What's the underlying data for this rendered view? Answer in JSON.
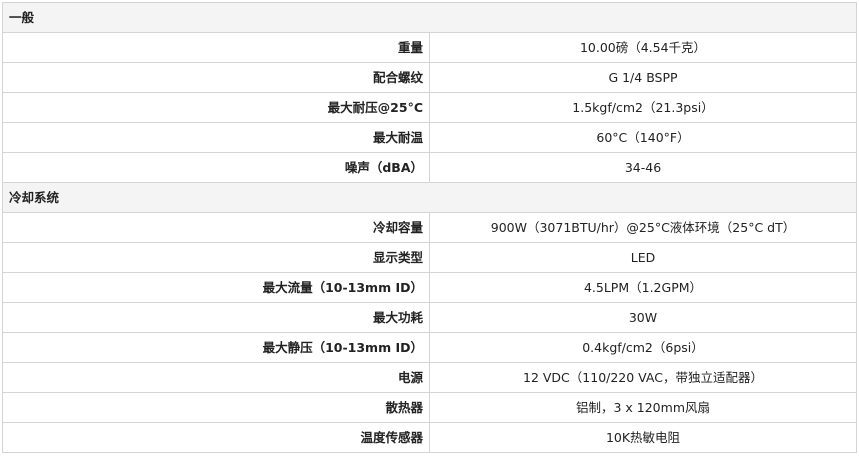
{
  "sections": [
    {
      "title": "一般",
      "rows": [
        {
          "label": "重量",
          "value": "10.00磅（4.54千克）"
        },
        {
          "label": "配合螺纹",
          "value": "G 1/4 BSPP"
        },
        {
          "label": "最大耐压@25°C",
          "value": "1.5kgf/cm2（21.3psi）"
        },
        {
          "label": "最大耐温",
          "value": "60°C（140°F）"
        },
        {
          "label": "噪声（dBA）",
          "value": "34-46"
        }
      ]
    },
    {
      "title": "冷却系统",
      "rows": [
        {
          "label": "冷却容量",
          "value": "900W（3071BTU/hr）@25°C液体环境（25°C dT）"
        },
        {
          "label": "显示类型",
          "value": "LED"
        },
        {
          "label": "最大流量（10-13mm ID）",
          "value": "4.5LPM（1.2GPM）"
        },
        {
          "label": "最大功耗",
          "value": "30W"
        },
        {
          "label": "最大静压（10-13mm ID）",
          "value": "0.4kgf/cm2（6psi）"
        },
        {
          "label": "电源",
          "value": "12 VDC（110/220 VAC，带独立适配器）"
        },
        {
          "label": "散热器",
          "value": "铝制，3 x 120mm风扇"
        },
        {
          "label": "温度传感器",
          "value": "10K热敏电阻"
        }
      ]
    }
  ]
}
